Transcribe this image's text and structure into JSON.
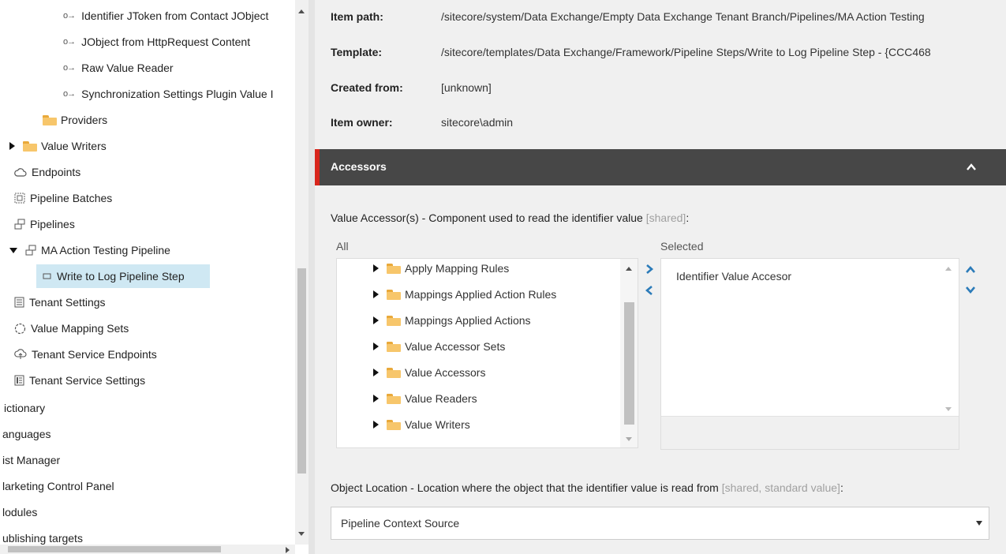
{
  "tree": {
    "items": [
      {
        "label": "Identifier JToken from Contact JObject",
        "icon": "link-arrow-icon"
      },
      {
        "label": "JObject from HttpRequest Content",
        "icon": "link-arrow-icon"
      },
      {
        "label": "Raw Value Reader",
        "icon": "link-arrow-icon"
      },
      {
        "label": "Synchronization Settings Plugin Value I",
        "icon": "link-arrow-icon"
      },
      {
        "label": "Providers",
        "icon": "folder-icon"
      },
      {
        "label": "Value Writers",
        "icon": "folder-icon"
      },
      {
        "label": "Endpoints",
        "icon": "cloud-icon"
      },
      {
        "label": "Pipeline Batches",
        "icon": "batch-icon"
      },
      {
        "label": "Pipelines",
        "icon": "pipeline-icon"
      },
      {
        "label": "MA Action Testing Pipeline",
        "icon": "pipeline-icon"
      },
      {
        "label": "Write to Log Pipeline Step",
        "icon": "step-icon"
      },
      {
        "label": "Tenant Settings",
        "icon": "document-icon"
      },
      {
        "label": "Value Mapping Sets",
        "icon": "dotted-circle-icon"
      },
      {
        "label": "Tenant Service Endpoints",
        "icon": "cloud-upload-icon"
      },
      {
        "label": "Tenant Service Settings",
        "icon": "document-list-icon"
      },
      {
        "label": "ictionary",
        "icon": ""
      },
      {
        "label": "anguages",
        "icon": ""
      },
      {
        "label": "ist Manager",
        "icon": ""
      },
      {
        "label": "larketing Control Panel",
        "icon": ""
      },
      {
        "label": "lodules",
        "icon": ""
      },
      {
        "label": "ublishing targets",
        "icon": ""
      }
    ]
  },
  "info": {
    "item_path_label": "Item path:",
    "item_path_value": "/sitecore/system/Data Exchange/Empty Data Exchange Tenant Branch/Pipelines/MA Action Testing",
    "template_label": "Template:",
    "template_value": "/sitecore/templates/Data Exchange/Framework/Pipeline Steps/Write to Log Pipeline Step - {CCC468",
    "created_label": "Created from:",
    "created_value": "[unknown]",
    "owner_label": "Item owner:",
    "owner_value": "sitecore\\admin"
  },
  "section": {
    "title": "Accessors"
  },
  "value_accessor": {
    "label": "Value Accessor(s) - Component used to read the identifier value ",
    "meta": "[shared]",
    "suffix": ":",
    "all_caption": "All",
    "selected_caption": "Selected",
    "all_items": [
      "Apply Mapping Rules",
      "Mappings Applied Action Rules",
      "Mappings Applied Actions",
      "Value Accessor Sets",
      "Value Accessors",
      "Value Readers",
      "Value Writers"
    ],
    "selected_items": [
      "Identifier Value Accesor"
    ]
  },
  "object_location": {
    "label": "Object Location - Location where the object that the identifier value is read from ",
    "meta": "[shared, standard value]",
    "suffix": ":",
    "selected_value": "Pipeline Context Source"
  },
  "colors": {
    "section_header_bg": "#474747",
    "section_accent": "#d8261c",
    "selected_row_bg": "#cfe8f3",
    "arrow_blue": "#2b7bb9",
    "folder": "#f7c66b"
  }
}
